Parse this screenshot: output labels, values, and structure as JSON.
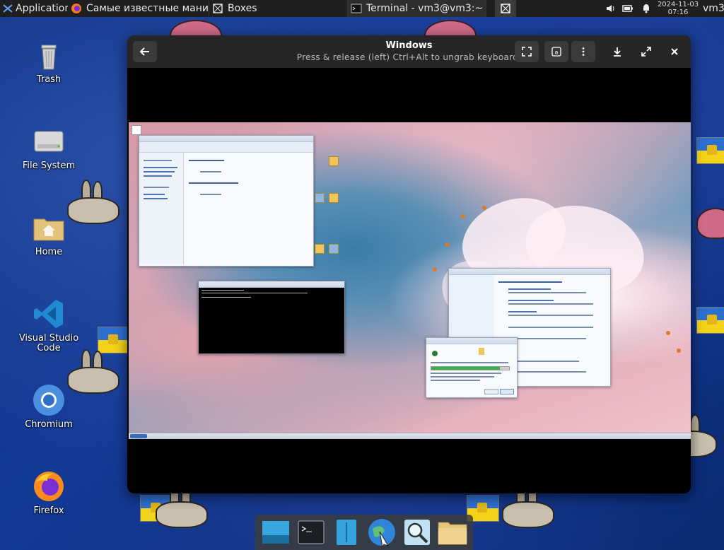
{
  "top_panel": {
    "applications_label": "Applications",
    "tasks": [
      {
        "label": "Самые известные манип...",
        "icon": "firefox-icon"
      },
      {
        "label": "Boxes",
        "icon": "boxes-icon"
      },
      {
        "label": "Terminal - vm3@vm3:~",
        "icon": "terminal-icon"
      }
    ],
    "clock_date": "2024-11-03",
    "clock_time": "07:16",
    "user": "vm3"
  },
  "desktop_icons": [
    {
      "label": "Trash",
      "icon": "trash-icon"
    },
    {
      "label": "File System",
      "icon": "drive-icon"
    },
    {
      "label": "Home",
      "icon": "home-folder-icon"
    },
    {
      "label": "Visual Studio Code",
      "icon": "vscode-icon"
    },
    {
      "label": "Chromium",
      "icon": "chromium-icon"
    },
    {
      "label": "Firefox",
      "icon": "firefox-icon"
    }
  ],
  "boxes_window": {
    "title": "Windows",
    "subtitle": "Press & release (left) Ctrl+Alt to ungrab keyboard."
  },
  "colors": {
    "panel_bg": "#1f1f1f",
    "headerbar_bg": "#262626",
    "desktop_blue": "#133a96"
  }
}
